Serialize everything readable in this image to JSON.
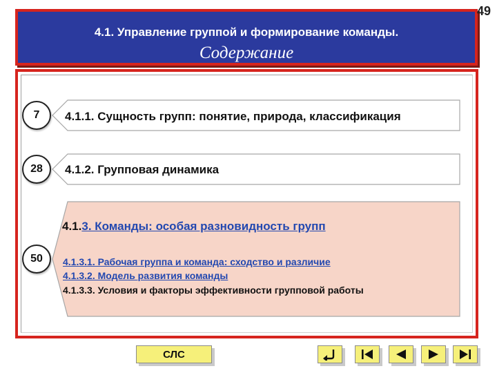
{
  "header": {
    "title": "4.1. Управление группой и формирование команды.",
    "subtitle": "Содержание",
    "page_number": "49"
  },
  "sections": [
    {
      "number": "7",
      "label": "4.1.1. Сущность групп: понятие, природа, классификация"
    },
    {
      "number": "28",
      "label": "4.1.2. Групповая динамика"
    },
    {
      "number": "50",
      "label_prefix": "4.1.",
      "label_link": "3. Команды: особая разновидность групп ",
      "subitems": [
        {
          "label": "4.1.3.1. Рабочая группа и команда: сходство и различие",
          "link": true
        },
        {
          "label": "4.1.3.2. Модель развития команды",
          "link": true
        },
        {
          "label": "4.1.3.3. Условия и факторы эффективности групповой работы",
          "link": false
        }
      ]
    }
  ],
  "footer": {
    "slc_label": "СЛС",
    "nav": [
      "return-icon",
      "first-icon",
      "previous-icon",
      "next-icon",
      "last-icon"
    ]
  },
  "colors": {
    "header_bg": "#2b3a9e",
    "frame_red": "#d6241e",
    "highlight_bg": "#f7d5c8",
    "button_yellow": "#f6f07a",
    "link_blue": "#2348b0"
  }
}
